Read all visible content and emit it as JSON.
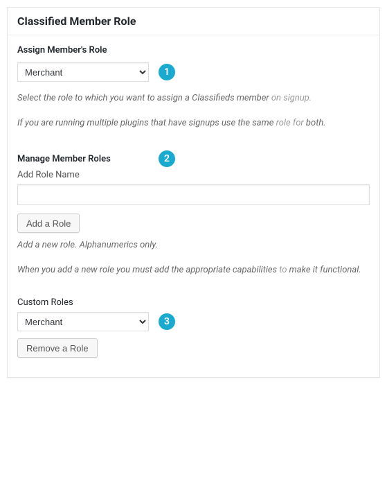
{
  "header": {
    "title": "Classified Member Role"
  },
  "badges": {
    "one": "1",
    "two": "2",
    "three": "3"
  },
  "assign": {
    "label": "Assign Member's Role",
    "selected": "Merchant",
    "desc_a": "Select the role to which you want to assign a Classifieds member",
    "desc_a_faint": " on signup.",
    "desc_b_pre": "If you are running multiple plugins that have signups use the",
    "desc_b_mid": " same ",
    "desc_b_faint": "role for",
    "desc_b_end": " both."
  },
  "manage": {
    "label": "Manage Member Roles",
    "add_label": "Add Role Name",
    "input_value": "",
    "add_button": "Add a Role",
    "desc_a": "Add a new role. Alphanumerics only.",
    "desc_b_pre": "When you add a new role you must add the appropriate capabilities",
    "desc_b_faint": " to",
    "desc_b_end": " make it functional."
  },
  "custom": {
    "label": "Custom Roles",
    "selected": "Merchant",
    "remove_button": "Remove a Role"
  }
}
